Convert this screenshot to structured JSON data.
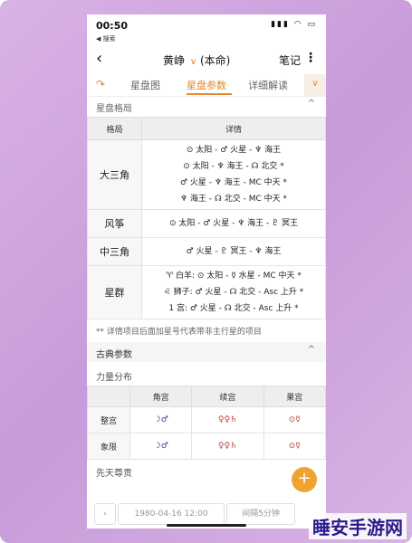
{
  "status": {
    "time": "00:50",
    "back_app": "◀ 搜索",
    "icons": "▮▮▮ ◠ ▭"
  },
  "nav": {
    "back": "‹",
    "title": "黄峥",
    "chev": "∨",
    "subtitle": "(本命)",
    "notes": "笔记",
    "more": "⋮"
  },
  "tabs": {
    "icon": "↷",
    "items": [
      "星盘图",
      "星盘参数",
      "详细解读"
    ],
    "active_index": 1,
    "collapse": "∨"
  },
  "section_pattern": {
    "label": "星盘格局",
    "chev": "^"
  },
  "aspects_table": {
    "headers": [
      "格局",
      "详情"
    ],
    "rows": [
      {
        "name": "大三角",
        "lines": [
          "⊙ 太阳 - ♂ 火星 - ♆ 海王",
          "⊙ 太阳 - ♆ 海王 - ☊ 北交 *",
          "♂ 火星 - ♆ 海王 - MC 中天 *",
          "♆ 海王 - ☊ 北交 - MC 中天 *"
        ]
      },
      {
        "name": "风筝",
        "lines": [
          "⊙ 太阳 - ♂ 火星 - ♆ 海王 - ♇ 冥王"
        ]
      },
      {
        "name": "中三角",
        "lines": [
          "♂ 火星 - ♇ 冥王 - ♆ 海王"
        ]
      },
      {
        "name": "星群",
        "lines": [
          "♈ 白羊: ⊙ 太阳 - ☿ 水星 - MC 中天 *",
          "♌ 狮子: ♂ 火星 - ☊ 北交 - Asc 上升 *",
          "1 宫: ♂ 火星 - ☊ 北交 - Asc 上升 *"
        ]
      }
    ]
  },
  "note": "** 详情项目后面加星号代表带非主行星的项目",
  "classic": {
    "label": "古典参数",
    "chev": "^"
  },
  "power": {
    "label": "力量分布",
    "headers": [
      "",
      "角宫",
      "续宫",
      "果宫"
    ],
    "rows": [
      {
        "name": "整宫",
        "cells": [
          "☽♂",
          "♀♀♄",
          "⊙☿"
        ]
      },
      {
        "name": "象限",
        "cells": [
          "☽♂",
          "♀♀♄",
          "⊙☿"
        ]
      }
    ]
  },
  "dignity": {
    "label": "先天尊贵"
  },
  "datebar": {
    "prev": "‹",
    "date": "1980-04-16 12:00",
    "interval": "间隔5分钟"
  },
  "fab": "+",
  "watermark": "睡安手游网"
}
